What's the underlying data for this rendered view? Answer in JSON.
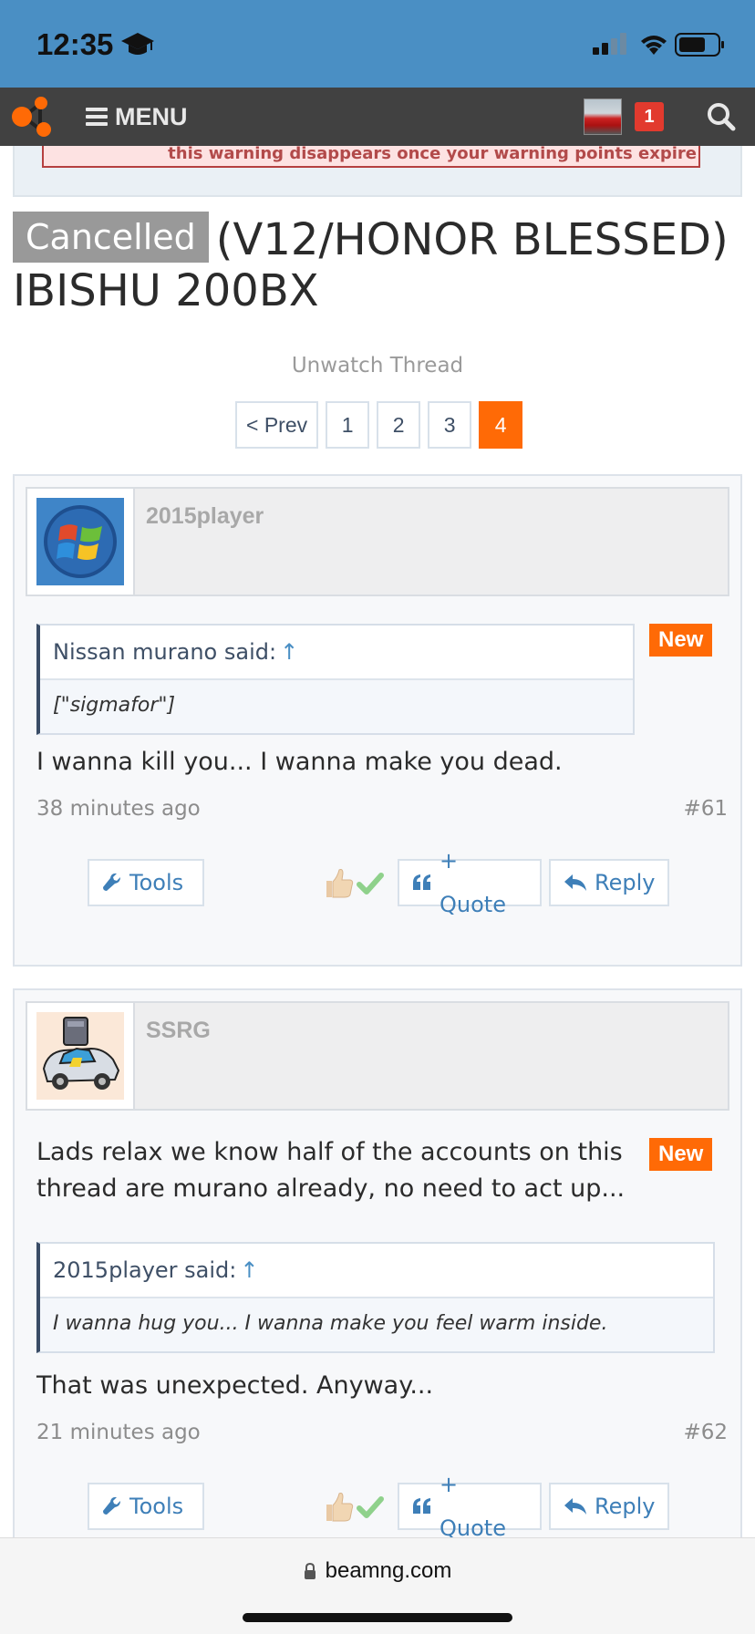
{
  "status_bar": {
    "time": "12:35"
  },
  "navbar": {
    "menu_label": "MENU",
    "alert_count": "1"
  },
  "warning": {
    "text": "this warning disappears once your warning points expire"
  },
  "thread": {
    "prefix": "Cancelled",
    "title": "(V12/HONOR BLESSED) IBISHU 200BX",
    "unwatch_label": "Unwatch Thread"
  },
  "pagination": {
    "prev_label": "< Prev",
    "pages": [
      "1",
      "2",
      "3",
      "4"
    ],
    "current_page": "4"
  },
  "posts": [
    {
      "username": "2015player",
      "badge": "New",
      "quote_author": "Nissan murano said:",
      "quote_arrow": "↑",
      "quote_text": "[\"sigmafor\"]",
      "message": "I wanna kill you... I wanna make you dead.",
      "time": "38 minutes ago",
      "number": "#61",
      "tools_label": "Tools",
      "quote_label": "+ Quote",
      "reply_label": "Reply"
    },
    {
      "username": "SSRG",
      "badge": "New",
      "message_before": "Lads relax we know half of the accounts on this thread are murano already, no need to act up...",
      "quote_author": "2015player said:",
      "quote_arrow": "↑",
      "quote_text": "I wanna hug you... I wanna make you feel warm inside.",
      "message": "That was unexpected. Anyway...",
      "time": "21 minutes ago",
      "number": "#62",
      "tools_label": "Tools",
      "quote_label": "+ Quote",
      "reply_label": "Reply"
    }
  ],
  "browser": {
    "url": "beamng.com"
  },
  "colors": {
    "accent": "#ff6a06",
    "status_bar": "#4a8fc4",
    "navbar": "#414141",
    "link": "#3e7fb8"
  }
}
